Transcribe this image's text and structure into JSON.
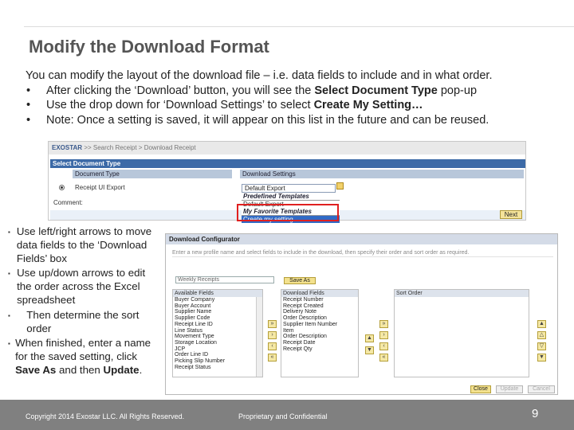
{
  "slide": {
    "title": "Modify the Download Format",
    "intro": "You can modify the layout of the download file – i.e. data fields to include and in what order.",
    "intro_bullets": [
      {
        "pre": "After clicking the ‘Download’ button, you will see the ",
        "bold": "Select Document Type",
        "post": " pop-up"
      },
      {
        "pre": "Use the drop down for ‘Download Settings’ to select ",
        "bold": "Create My Setting…",
        "post": ""
      },
      {
        "pre": "Note:  Once a setting is saved, it will appear on this list in the future and can be reused.",
        "bold": "",
        "post": ""
      }
    ],
    "bullet_char": "•"
  },
  "shot1": {
    "brand": "EXOSTAR",
    "breadcrumb": ">> Search Receipt > Download Receipt",
    "header": "Select Document Type",
    "col_doc_type": "Document Type",
    "col_dl_settings": "Download Settings",
    "row_doc": "Receipt UI Export",
    "select_value": "Default Export",
    "dropdown": {
      "group1": "Predefined Templates",
      "opt1": "Default Export",
      "group2": "My Favorite Templates",
      "selected": "Create my setting..."
    },
    "comment_label": "Comment:",
    "next_button": "Next"
  },
  "side": {
    "bullets": [
      {
        "pre": "Use left/right arrows to move data fields to the ‘Download Fields’ box",
        "bold": "",
        "mid": "",
        "bold2": "",
        "post": ""
      },
      {
        "pre": "Use up/down arrows to edit the order across the Excel spreadsheet",
        "bold": "",
        "mid": "",
        "bold2": "",
        "post": ""
      },
      {
        "pre": "Then determine the sort order",
        "bold": "",
        "mid": "",
        "bold2": "",
        "post": ""
      },
      {
        "pre": "When finished, enter a name for the saved setting, click ",
        "bold": "Save As",
        "mid": " and then ",
        "bold2": "Update",
        "post": "."
      }
    ],
    "bullet_char": "▪"
  },
  "shot2": {
    "header": "Download Configurator",
    "instructions": "Enter a new profile name and select fields to include in the download, then specify their order and sort order as required.",
    "name_input": "Weekly Receipts",
    "save_as": "Save As",
    "available_header": "Available Fields",
    "available": [
      "Buyer Company",
      "Buyer Account",
      "Supplier Name",
      "Supplier Code",
      "Receipt Line ID",
      "Line Status",
      "Movement Type",
      "Storage Location",
      "JCP",
      "Order Line ID",
      "Picking Slip Number",
      "Receipt Status"
    ],
    "download_header": "Download Fields",
    "download": [
      "Receipt Number",
      "Receipt Created",
      "Delivery Note",
      "Order Description",
      "Supplier Item Number",
      "Item",
      "Order Description",
      "Receipt Date",
      "Receipt Qty"
    ],
    "sort_header": "Sort Order",
    "btn_close": "Close",
    "btn_update": "Update",
    "btn_cancel": "Cancel"
  },
  "footer": {
    "copyright": "Copyright 2014 Exostar LLC. All Rights Reserved.",
    "proprietary": "Proprietary and Confidential",
    "page_number": "9"
  }
}
